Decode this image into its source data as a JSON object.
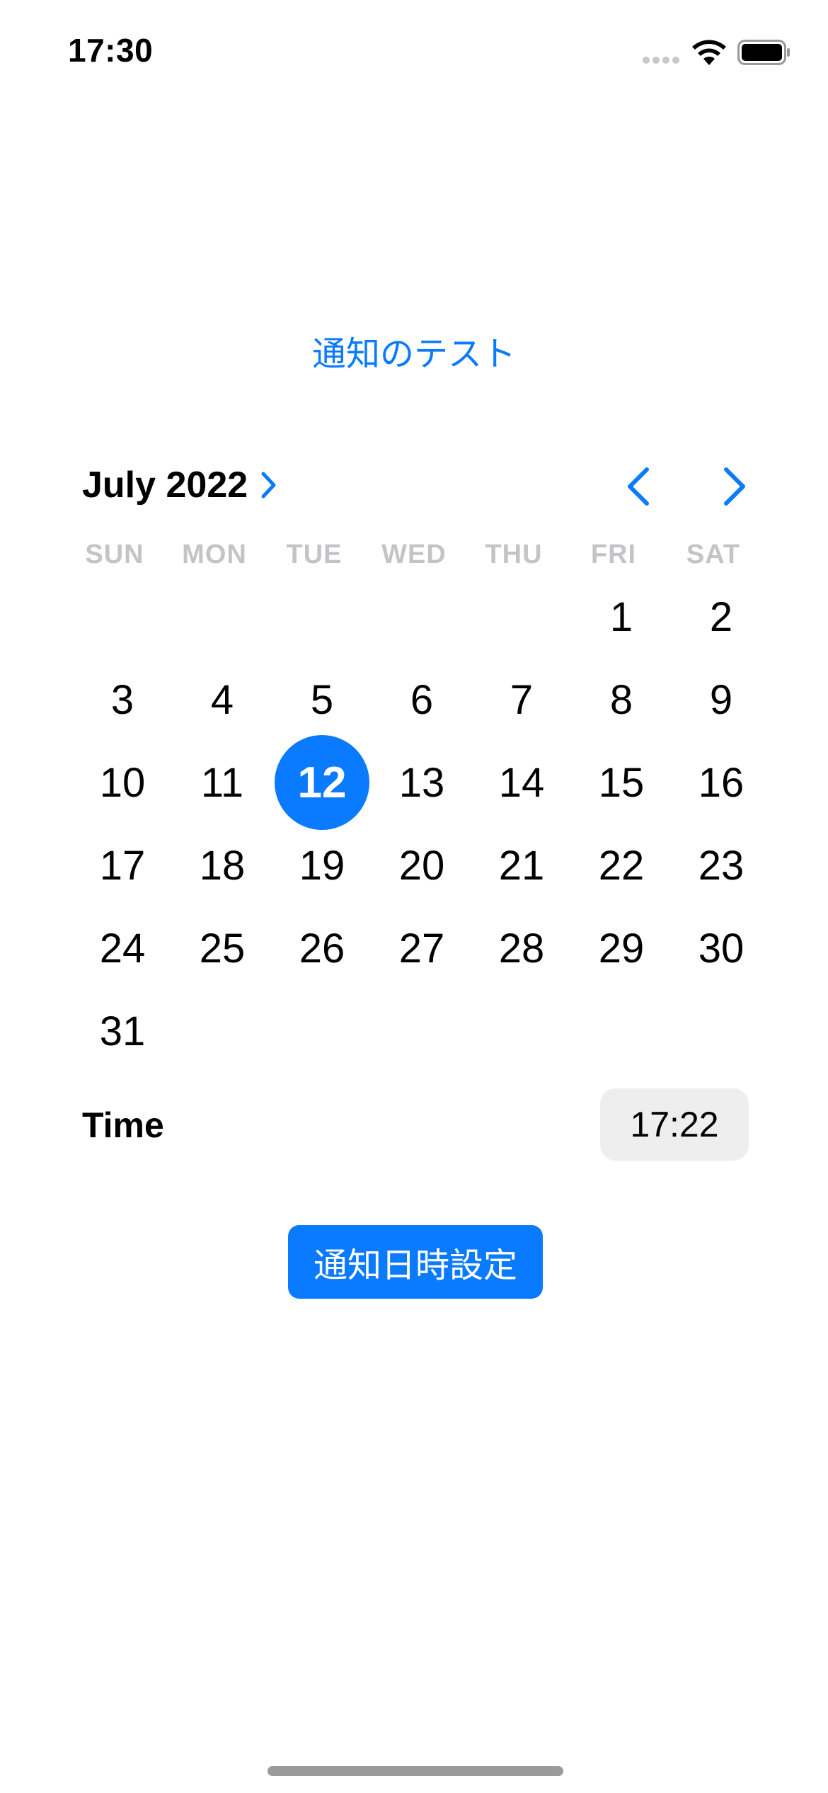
{
  "status_bar": {
    "time": "17:30"
  },
  "header": {
    "test_link": "通知のテスト"
  },
  "calendar": {
    "month_label": "July 2022",
    "weekdays": [
      "SUN",
      "MON",
      "TUE",
      "WED",
      "THU",
      "FRI",
      "SAT"
    ],
    "days": [
      "1",
      "2",
      "3",
      "4",
      "5",
      "6",
      "7",
      "8",
      "9",
      "10",
      "11",
      "12",
      "13",
      "14",
      "15",
      "16",
      "17",
      "18",
      "19",
      "20",
      "21",
      "22",
      "23",
      "24",
      "25",
      "26",
      "27",
      "28",
      "29",
      "30",
      "31"
    ],
    "selected_day": 12,
    "accent_color": "#0a7aff"
  },
  "time_row": {
    "label": "Time",
    "value": "17:22"
  },
  "action": {
    "set_button_label": "通知日時設定"
  }
}
